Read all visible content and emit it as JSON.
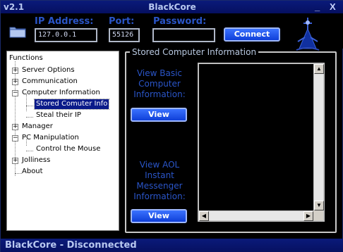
{
  "window": {
    "version": "v2.1",
    "title": "BlackCore",
    "minimize_glyph": "_",
    "close_glyph": "X"
  },
  "connection": {
    "ip_label": "IP Address:",
    "ip_value": "127.0.0.1",
    "port_label": "Port:",
    "port_value": "55126",
    "password_label": "Password:",
    "password_value": "",
    "connect_label": "Connect"
  },
  "tree": {
    "root": "Functions",
    "items": [
      {
        "label": "Server Options",
        "expander": "+"
      },
      {
        "label": "Communication",
        "expander": "+"
      },
      {
        "label": "Computer Information",
        "expander": "−"
      },
      {
        "label": "Stored Comuter Info"
      },
      {
        "label": "Steal their IP"
      },
      {
        "label": "Manager",
        "expander": "+"
      },
      {
        "label": "PC Manipulation",
        "expander": "−"
      },
      {
        "label": "Control the Mouse"
      },
      {
        "label": "Jolliness",
        "expander": "+"
      },
      {
        "label": "About"
      }
    ]
  },
  "stored_info": {
    "group_title": "Stored Computer Information",
    "basic_lines": [
      "View Basic",
      "Computer",
      "Information:"
    ],
    "basic_button": "View",
    "aol_lines": [
      "View AOL",
      "Instant",
      "Messenger",
      "Information:"
    ],
    "aol_button": "View"
  },
  "status": {
    "text": "BlackCore - Disconnected"
  },
  "colors": {
    "title_bar": "#0a1a7a",
    "accent_text": "#2a55c8",
    "button": "#1f4ff0",
    "selection": "#0a1a8a"
  },
  "icons": [
    "folder-icon",
    "wizard-logo-icon",
    "minimize-icon",
    "close-icon"
  ]
}
